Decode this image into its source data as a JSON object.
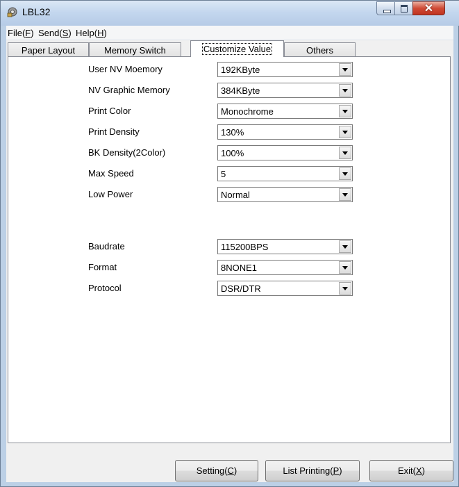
{
  "window": {
    "title": "LBL32"
  },
  "menu": {
    "file": {
      "text": "File(",
      "key": "F",
      "close": ")"
    },
    "send": {
      "text": "Send(",
      "key": "S",
      "close": ")"
    },
    "help": {
      "text": "Help(",
      "key": "H",
      "close": ")"
    }
  },
  "tabs": [
    {
      "label": "Paper Layout"
    },
    {
      "label": "Memory Switch"
    },
    {
      "label": "Customize Value",
      "selected": true
    },
    {
      "label": "Others"
    }
  ],
  "settings": [
    {
      "label": "User NV Moemory",
      "value": "192KByte"
    },
    {
      "label": "NV Graphic Memory",
      "value": "384KByte"
    },
    {
      "label": "Print Color",
      "value": "Monochrome"
    },
    {
      "label": "Print Density",
      "value": "130%"
    },
    {
      "label": "BK Density(2Color)",
      "value": "100%"
    },
    {
      "label": "Max Speed",
      "value": "5"
    },
    {
      "label": "Low Power",
      "value": "Normal"
    },
    {
      "label": "Baudrate",
      "value": "115200BPS"
    },
    {
      "label": "Format",
      "value": "8NONE1"
    },
    {
      "label": "Protocol",
      "value": "DSR/DTR"
    }
  ],
  "buttons": {
    "setting": {
      "text": "Setting(",
      "key": "C",
      "close": ")"
    },
    "list_printing": {
      "text": "List Printing(",
      "key": "P",
      "close": ")"
    },
    "exit": {
      "text": "Exit(",
      "key": "X",
      "close": ")"
    }
  },
  "icons": {
    "app": "printer-gear-icon"
  },
  "colors": {
    "titlebar": "#c2d6ee",
    "close": "#cf4a35",
    "panel": "#ffffff",
    "face": "#f0f0f0"
  }
}
